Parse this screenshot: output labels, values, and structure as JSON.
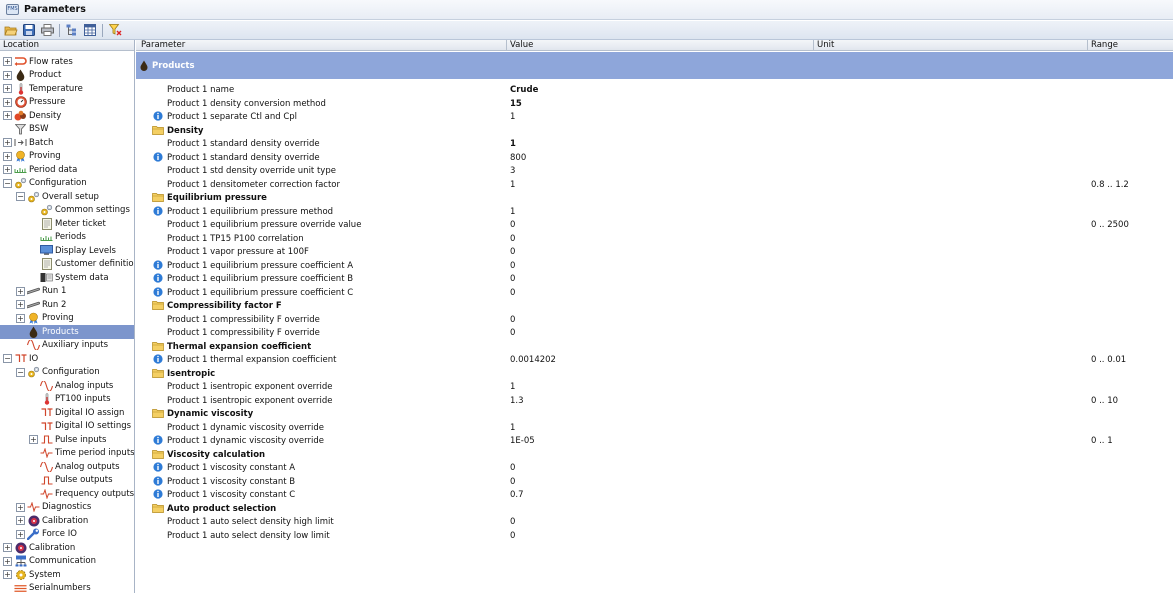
{
  "window": {
    "icon_text": "FMS",
    "title": "Parameters"
  },
  "toolbar": {
    "buttons": [
      "open-icon",
      "save-icon",
      "print-icon",
      "tree-icon",
      "grid-icon",
      "filter-icon"
    ]
  },
  "left_header": "Location",
  "columns": {
    "parameter": "Parameter",
    "value": "Value",
    "unit": "Unit",
    "range": "Range"
  },
  "tree": [
    {
      "label": "Flow rates",
      "icon": "flow-icon",
      "indent": 0,
      "exp": "+"
    },
    {
      "label": "Product",
      "icon": "drop-icon",
      "indent": 0,
      "exp": "+"
    },
    {
      "label": "Temperature",
      "icon": "thermometer-icon",
      "indent": 0,
      "exp": "+"
    },
    {
      "label": "Pressure",
      "icon": "gauge-icon",
      "indent": 0,
      "exp": "+"
    },
    {
      "label": "Density",
      "icon": "density-icon",
      "indent": 0,
      "exp": "+"
    },
    {
      "label": "BSW",
      "icon": "funnel-icon",
      "indent": 0,
      "exp": ""
    },
    {
      "label": "Batch",
      "icon": "batch-icon",
      "indent": 0,
      "exp": "+"
    },
    {
      "label": "Proving",
      "icon": "medal-icon",
      "indent": 0,
      "exp": "+"
    },
    {
      "label": "Period data",
      "icon": "period-icon",
      "indent": 0,
      "exp": "+"
    },
    {
      "label": "Configuration",
      "icon": "gears-icon",
      "indent": 0,
      "exp": "-"
    },
    {
      "label": "Overall setup",
      "icon": "gears-icon",
      "indent": 1,
      "exp": "-"
    },
    {
      "label": "Common settings",
      "icon": "gears-icon",
      "indent": 2,
      "exp": ""
    },
    {
      "label": "Meter ticket",
      "icon": "document-icon",
      "indent": 2,
      "exp": ""
    },
    {
      "label": "Periods",
      "icon": "period-icon",
      "indent": 2,
      "exp": ""
    },
    {
      "label": "Display Levels",
      "icon": "monitor-icon",
      "indent": 2,
      "exp": ""
    },
    {
      "label": "Customer definition",
      "icon": "document-icon",
      "indent": 2,
      "exp": ""
    },
    {
      "label": "System data",
      "icon": "system-data-icon",
      "indent": 2,
      "exp": ""
    },
    {
      "label": "Run 1",
      "icon": "pipe-icon",
      "indent": 1,
      "exp": "+"
    },
    {
      "label": "Run 2",
      "icon": "pipe-icon",
      "indent": 1,
      "exp": "+"
    },
    {
      "label": "Proving",
      "icon": "medal-icon",
      "indent": 1,
      "exp": "+"
    },
    {
      "label": "Products",
      "icon": "drop-icon",
      "indent": 1,
      "exp": "",
      "selected": true
    },
    {
      "label": "Auxiliary inputs",
      "icon": "analog-icon",
      "indent": 1,
      "exp": ""
    },
    {
      "label": "IO",
      "icon": "io-icon",
      "indent": 0,
      "exp": "-"
    },
    {
      "label": "Configuration",
      "icon": "gears-icon",
      "indent": 1,
      "exp": "-"
    },
    {
      "label": "Analog inputs",
      "icon": "analog-icon",
      "indent": 2,
      "exp": ""
    },
    {
      "label": "PT100 inputs",
      "icon": "thermometer-icon",
      "indent": 2,
      "exp": ""
    },
    {
      "label": "Digital IO assign",
      "icon": "io-icon",
      "indent": 2,
      "exp": ""
    },
    {
      "label": "Digital IO settings",
      "icon": "io-icon",
      "indent": 2,
      "exp": ""
    },
    {
      "label": "Pulse inputs",
      "icon": "pulse-icon",
      "indent": 2,
      "exp": "+"
    },
    {
      "label": "Time period inputs",
      "icon": "wave-icon",
      "indent": 2,
      "exp": ""
    },
    {
      "label": "Analog outputs",
      "icon": "analog-icon",
      "indent": 2,
      "exp": ""
    },
    {
      "label": "Pulse outputs",
      "icon": "pulse-icon",
      "indent": 2,
      "exp": ""
    },
    {
      "label": "Frequency outputs",
      "icon": "wave-icon",
      "indent": 2,
      "exp": ""
    },
    {
      "label": "Diagnostics",
      "icon": "wave-icon",
      "indent": 1,
      "exp": "+"
    },
    {
      "label": "Calibration",
      "icon": "calibration-icon",
      "indent": 1,
      "exp": "+"
    },
    {
      "label": "Force IO",
      "icon": "wrench-icon",
      "indent": 1,
      "exp": "+"
    },
    {
      "label": "Calibration",
      "icon": "calibration-icon",
      "indent": 0,
      "exp": "+"
    },
    {
      "label": "Communication",
      "icon": "network-icon",
      "indent": 0,
      "exp": "+"
    },
    {
      "label": "System",
      "icon": "gear-icon",
      "indent": 0,
      "exp": "+"
    },
    {
      "label": "Serialnumbers",
      "icon": "serial-icon",
      "indent": 0,
      "exp": ""
    }
  ],
  "section": {
    "title": "Products"
  },
  "params": [
    {
      "t": "p",
      "name": "Product 1 name",
      "value": "Crude",
      "bold": true
    },
    {
      "t": "p",
      "name": "Product 1 density conversion method",
      "value": "15",
      "bold": true
    },
    {
      "t": "p",
      "name": "Product 1 separate Ctl and Cpl",
      "value": "1",
      "info": true
    },
    {
      "t": "g",
      "name": "Density"
    },
    {
      "t": "p",
      "name": "Product 1 standard density override",
      "value": "1",
      "bold": true
    },
    {
      "t": "p",
      "name": "Product 1 standard density override",
      "value": "800",
      "info": true
    },
    {
      "t": "p",
      "name": "Product 1 std density override unit type",
      "value": "3"
    },
    {
      "t": "p",
      "name": "Product 1 densitometer correction factor",
      "value": "1",
      "range": "0.8 .. 1.2"
    },
    {
      "t": "g",
      "name": "Equilibrium pressure"
    },
    {
      "t": "p",
      "name": "Product 1 equilibrium pressure method",
      "value": "1",
      "info": true
    },
    {
      "t": "p",
      "name": "Product 1 equilibrium pressure override value",
      "value": "0",
      "range": "0 .. 2500"
    },
    {
      "t": "p",
      "name": "Product 1 TP15 P100 correlation",
      "value": "0"
    },
    {
      "t": "p",
      "name": "Product 1 vapor pressure at 100F",
      "value": "0"
    },
    {
      "t": "p",
      "name": "Product 1 equilibrium pressure coefficient A",
      "value": "0",
      "info": true
    },
    {
      "t": "p",
      "name": "Product 1 equilibrium pressure coefficient B",
      "value": "0",
      "info": true
    },
    {
      "t": "p",
      "name": "Product 1 equilibrium pressure coefficient C",
      "value": "0",
      "info": true
    },
    {
      "t": "g",
      "name": "Compressibility factor F"
    },
    {
      "t": "p",
      "name": "Product 1 compressibility F override",
      "value": "0"
    },
    {
      "t": "p",
      "name": "Product 1 compressibility F override",
      "value": "0"
    },
    {
      "t": "g",
      "name": "Thermal expansion coefficient"
    },
    {
      "t": "p",
      "name": "Product 1 thermal expansion coefficient",
      "value": "0.0014202",
      "info": true,
      "range": "0 .. 0.01"
    },
    {
      "t": "g",
      "name": "Isentropic"
    },
    {
      "t": "p",
      "name": "Product 1 isentropic exponent override",
      "value": "1"
    },
    {
      "t": "p",
      "name": "Product 1 isentropic exponent override",
      "value": "1.3",
      "range": "0 .. 10"
    },
    {
      "t": "g",
      "name": "Dynamic viscosity"
    },
    {
      "t": "p",
      "name": "Product 1 dynamic viscosity override",
      "value": "1"
    },
    {
      "t": "p",
      "name": "Product 1 dynamic viscosity override",
      "value": "1E-05",
      "info": true,
      "range": "0 .. 1"
    },
    {
      "t": "g",
      "name": "Viscosity calculation"
    },
    {
      "t": "p",
      "name": "Product 1 viscosity constant A",
      "value": "0",
      "info": true
    },
    {
      "t": "p",
      "name": "Product 1 viscosity constant B",
      "value": "0",
      "info": true
    },
    {
      "t": "p",
      "name": "Product 1 viscosity constant C",
      "value": "0.7",
      "info": true
    },
    {
      "t": "g",
      "name": "Auto product selection"
    },
    {
      "t": "p",
      "name": "Product 1 auto select density high limit",
      "value": "0"
    },
    {
      "t": "p",
      "name": "Product 1 auto select density low limit",
      "value": "0"
    }
  ]
}
